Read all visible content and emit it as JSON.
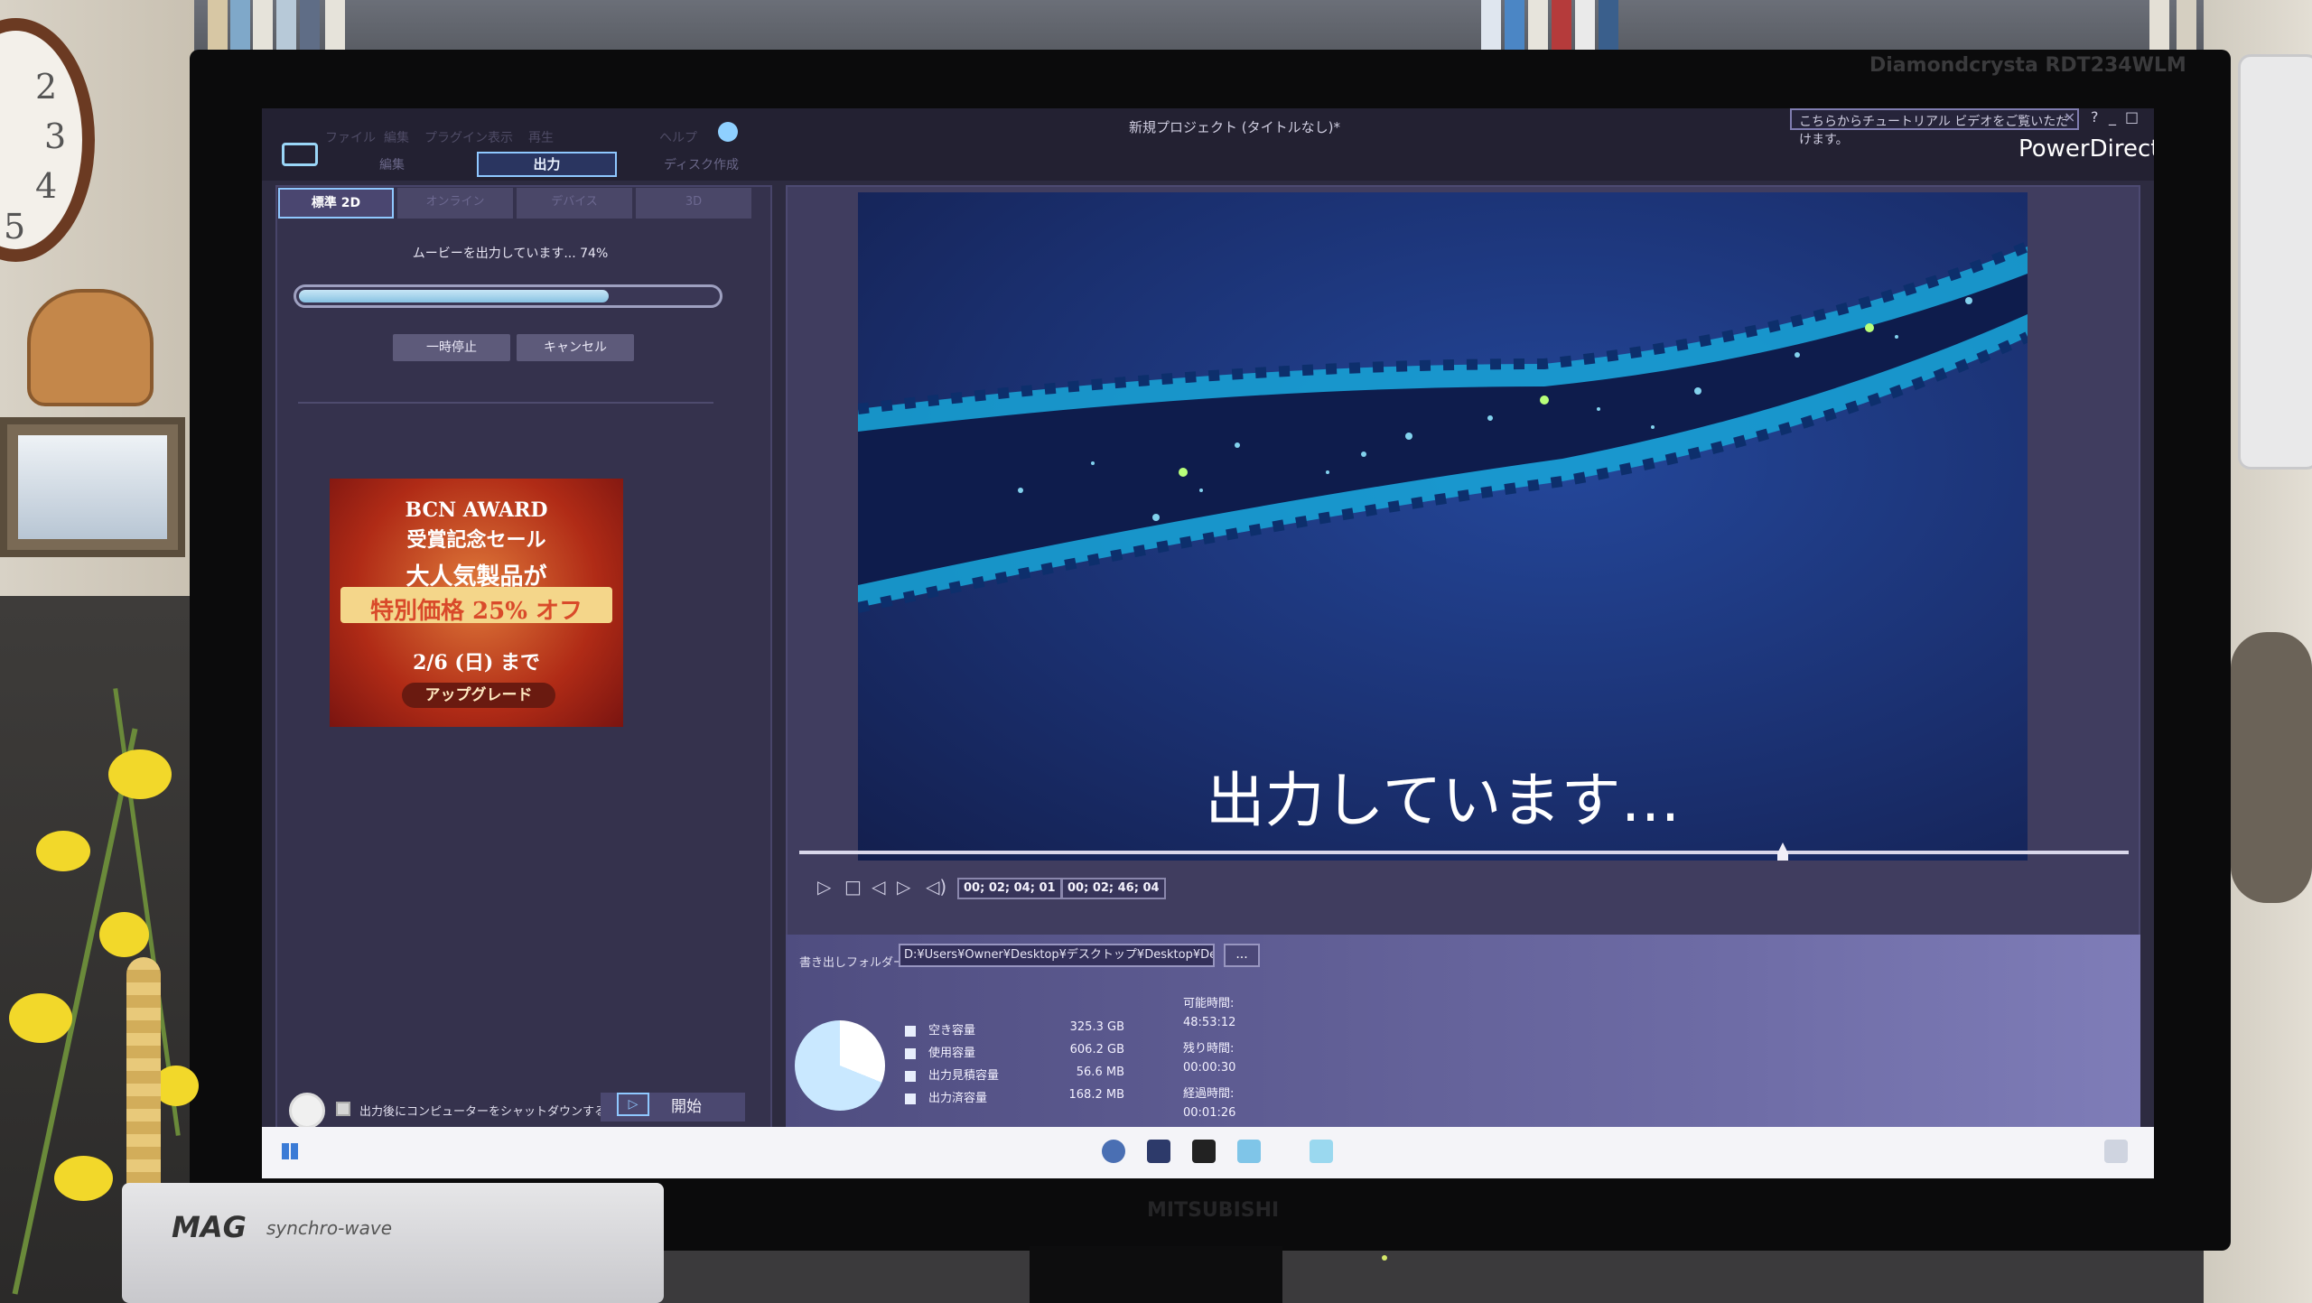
{
  "monitor": {
    "model": "Diamondcrysta RDT234WLM",
    "brand": "MITSUBISHI"
  },
  "room": {
    "device_brand": "MAG",
    "device_model": "synchro-wave",
    "clock_numbers": [
      "2",
      "3",
      "4",
      "5"
    ]
  },
  "app": {
    "project_title": "新規プロジェクト (タイトルなし)*",
    "app_name": "PowerDirector",
    "notice": "こちらからチュートリアル ビデオをご覧いただけます。",
    "menu": [
      "ファイル",
      "編集",
      "プラグイン",
      "表示",
      "再生",
      "ヘルプ"
    ],
    "modes": {
      "edit": "編集",
      "output": "出力",
      "disc": "ディスク作成"
    },
    "window_buttons": [
      "?",
      "_",
      "□"
    ]
  },
  "left_panel": {
    "tabs": [
      "標準 2D",
      "オンライン",
      "デバイス",
      "3D"
    ],
    "status_text": "ムービーを出力しています... 74%",
    "progress": 0.74,
    "pause_label": "一時停止",
    "cancel_label": "キャンセル",
    "ad": {
      "line1": "BCN AWARD",
      "line2": "受賞記念セール",
      "line3": "大人気製品が",
      "line4": "特別価格 25% オフ",
      "line5": "2/6 (日) まで",
      "button": "アップグレード"
    },
    "shutdown_label": "出力後にコンピューターをシャットダウンする",
    "start_label": "開始"
  },
  "preview": {
    "overlay_text": "出力しています…",
    "timecode_current": "00; 02; 04; 01",
    "timecode_total": "00; 02; 46; 04",
    "playhead_fraction": 0.74
  },
  "output": {
    "folder_label": "書き出しフォルダー:",
    "folder_path": "D:¥Users¥Owner¥Desktop¥デスクトップ¥Desktop¥Desktop",
    "browse_label": "...",
    "legend": [
      {
        "label": "空き容量",
        "value": "325.3",
        "unit": "GB"
      },
      {
        "label": "使用容量",
        "value": "606.2",
        "unit": "GB"
      },
      {
        "label": "出力見積容量",
        "value": "56.6",
        "unit": "MB"
      },
      {
        "label": "出力済容量",
        "value": "168.2",
        "unit": "MB"
      }
    ],
    "times": [
      {
        "label": "可能時間:",
        "value": "48:53:12"
      },
      {
        "label": "残り時間:",
        "value": "00:00:30"
      },
      {
        "label": "経過時間:",
        "value": "00:01:26"
      }
    ],
    "colors": {
      "accent": "#8fc8ff",
      "progress": "#9fd0ee",
      "free": "#ffffff",
      "used": "#c9e8ff"
    }
  }
}
